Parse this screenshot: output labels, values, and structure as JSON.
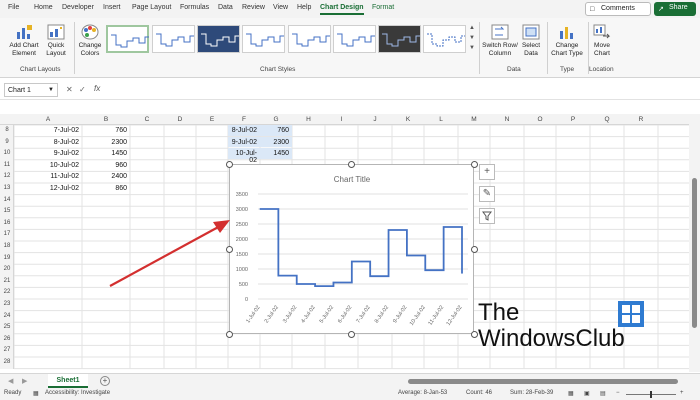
{
  "ribbon_tabs": [
    "File",
    "Home",
    "Developer",
    "Insert",
    "Page Layout",
    "Formulas",
    "Data",
    "Review",
    "View",
    "Help",
    "Chart Design",
    "Format"
  ],
  "active_tab": "Chart Design",
  "top_buttons": {
    "comments": "Comments",
    "share": "Share"
  },
  "ribbon": {
    "add_chart_element": "Add Chart\nElement",
    "quick_layout": "Quick\nLayout",
    "change_colors": "Change\nColors",
    "switch_row_column": "Switch Row/\nColumn",
    "select_data": "Select\nData",
    "change_chart_type": "Change\nChart Type",
    "move_chart": "Move\nChart",
    "groups": {
      "chart_layouts": "Chart Layouts",
      "chart_styles": "Chart Styles",
      "data": "Data",
      "type": "Type",
      "location": "Location"
    }
  },
  "formula_bar": {
    "name_box": "Chart 1",
    "fx": "fx",
    "value": ""
  },
  "columns": [
    "A",
    "B",
    "C",
    "D",
    "E",
    "F",
    "G",
    "H",
    "I",
    "J",
    "K",
    "L",
    "M",
    "N",
    "O",
    "P",
    "Q",
    "R"
  ],
  "rows": [
    "8",
    "9",
    "10",
    "11",
    "12",
    "13",
    "14",
    "15",
    "16",
    "17",
    "18",
    "19",
    "20",
    "21",
    "22",
    "23",
    "24",
    "25",
    "26",
    "27",
    "28"
  ],
  "sheet_data": [
    {
      "date": "7-Jul-02",
      "value": "760"
    },
    {
      "date": "8-Jul-02",
      "value": "2300"
    },
    {
      "date": "9-Jul-02",
      "value": "1450"
    },
    {
      "date": "10-Jul-02",
      "value": "960"
    },
    {
      "date": "11-Jul-02",
      "value": "2400"
    },
    {
      "date": "12-Jul-02",
      "value": "860"
    }
  ],
  "selected_data": [
    {
      "date": "8-Jul-02",
      "value": "760"
    },
    {
      "date": "9-Jul-02",
      "value": "2300"
    },
    {
      "date": "10-Jul-02",
      "value": "1450"
    }
  ],
  "chart_data": {
    "type": "line",
    "step": true,
    "title": "Chart Title",
    "categories": [
      "1-Jul-02",
      "2-Jul-02",
      "3-Jul-02",
      "4-Jul-02",
      "5-Jul-02",
      "6-Jul-02",
      "7-Jul-02",
      "8-Jul-02",
      "9-Jul-02",
      "10-Jul-02",
      "11-Jul-02",
      "12-Jul-02"
    ],
    "values": [
      3000,
      780,
      500,
      430,
      550,
      1250,
      760,
      2300,
      1450,
      960,
      2400,
      860
    ],
    "ylim": [
      0,
      3500
    ],
    "yticks": [
      0,
      500,
      1000,
      1500,
      2000,
      2500,
      3000,
      3500
    ],
    "grid": true,
    "line_color": "#4472c4"
  },
  "chart_side_buttons": [
    "chart-elements-plus",
    "chart-styles-brush",
    "chart-filters-funnel"
  ],
  "watermark": {
    "line1": "The",
    "line2": "WindowsClub"
  },
  "sheet_tab": "Sheet1",
  "status": {
    "ready": "Ready",
    "accessibility": "Accessibility: Investigate",
    "average": "Average: 8-Jan-53",
    "count": "Count: 46",
    "sum": "Sum: 28-Feb-39"
  },
  "colors": {
    "accent": "#1a6e35",
    "series": "#4472c4",
    "arrow": "#d32f2f",
    "selection": "#dbe8f7"
  }
}
